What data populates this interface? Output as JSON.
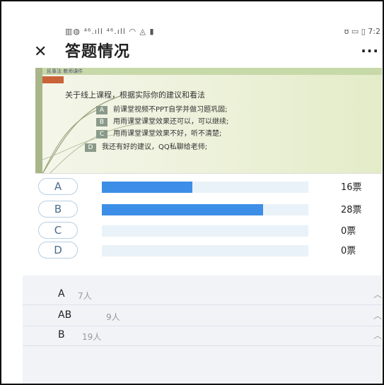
{
  "status_bar": {
    "left_icons": "▥◍ ⁴⁶.ıll ⁴⁶.ıll ◠ ◬ ▮",
    "right_text": "ʊ ▭ ▯ 7:2"
  },
  "title_bar": {
    "close_icon": "close-icon",
    "title": "答题情况",
    "more_icon": "more-icon"
  },
  "slide": {
    "header_text": "民事法 教师课件",
    "question": "关于线上课程，根据实际你的建议和看法",
    "options": [
      {
        "key": "A",
        "text": "前课堂视频不PPT自学并做习题巩固;"
      },
      {
        "key": "B",
        "text": "用雨课堂课堂效果还可以，可以继续;"
      },
      {
        "key": "C",
        "text": "用雨课堂课堂效果不好，听不清楚;"
      },
      {
        "key": "D",
        "text": "我还有好的建议，QQ私聊给老师;"
      }
    ]
  },
  "votes": [
    {
      "letter": "A",
      "count_label": "16票",
      "fraction": 0.44
    },
    {
      "letter": "B",
      "count_label": "28票",
      "fraction": 0.78
    },
    {
      "letter": "C",
      "count_label": "0票",
      "fraction": 0
    },
    {
      "letter": "D",
      "count_label": "0票",
      "fraction": 0
    }
  ],
  "answers": [
    {
      "key": "A",
      "count": "7人"
    },
    {
      "key": "AB",
      "count": "9人"
    },
    {
      "key": "B",
      "count": "19人"
    }
  ],
  "colors": {
    "bar_fill": "#3d8ee6",
    "bar_track": "#eaf2f9",
    "letter_border": "#b7cfe3"
  }
}
